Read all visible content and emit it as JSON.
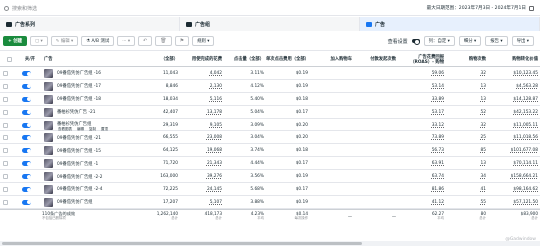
{
  "search": {
    "placeholder": "搜索和筛选"
  },
  "date_range": "最大日期范围：2023年7月3日 - 2024年7月1日",
  "level_tabs": [
    {
      "label": "广告系列",
      "icon": "folder-icon",
      "active": false
    },
    {
      "label": "广告组",
      "icon": "grid-icon",
      "active": false
    },
    {
      "label": "广告",
      "icon": "ad-icon",
      "active": true
    }
  ],
  "toolbar": {
    "create": "+ 创建",
    "copy": "▢ ▾",
    "edit": "✎ 编辑 ▾",
    "ab_test": "⚗ A/B 测试",
    "more": "··· ▾",
    "rules": "规则 ▾",
    "view_setting": "查看设置",
    "columns": "列：自定 ▾",
    "breakdown": "细分 ▾",
    "report": "报告 ▾",
    "export": "导出 ▾"
  },
  "columns": [
    "关/开",
    "广告",
    "（全部）",
    "用使完成的花费",
    "点击量（全部）",
    "单次点击费用（全部）",
    "加入购物车",
    "付款发起次数",
    "广告花费回报（ROAS）- 购物",
    "购物次数",
    "购物转化价值"
  ],
  "rows": [
    {
      "name": "09番茄凭仿广告组 -16",
      "c1": "11,043",
      "c2": "4,042",
      "c3": "3.11%",
      "c4": "$0.19",
      "c5": "",
      "c6": "",
      "c7": "59.06",
      "c8": "32",
      "c9": "$10,123.45"
    },
    {
      "name": "09番茄凭仿广告组 -17",
      "c1": "8,846",
      "c2": "2,130",
      "c3": "4.12%",
      "c4": "$0.19",
      "c5": "",
      "c6": "",
      "c7": "53.14",
      "c8": "13",
      "c9": "$4,563.28"
    },
    {
      "name": "09番茄凭仿广告组 -18",
      "c1": "18,034",
      "c2": "5,116",
      "c3": "5.40%",
      "c4": "$0.18",
      "c5": "",
      "c6": "",
      "c7": "33.89",
      "c8": "13",
      "c9": "$14,128.87"
    },
    {
      "name": "番柏衫凭仿广告 -21",
      "c1": "42,407",
      "c2": "13,178",
      "c3": "5.04%",
      "c4": "$0.17",
      "c5": "",
      "c6": "",
      "c7": "53.17",
      "c8": "52",
      "c9": "$42,153.22"
    },
    {
      "name": "番柏衫凭仿广告组",
      "c1": "29,319",
      "c2": "9,105",
      "c3": "3.09%",
      "c4": "$0.20",
      "c5": "",
      "c6": "",
      "c7": "33.12",
      "c8": "32",
      "c9": "$11,005.11",
      "actions": [
        "查看图表",
        "编辑",
        "复制",
        "置顶"
      ]
    },
    {
      "name": "09番茄凭仿广告组 -21",
      "c1": "66,555",
      "c2": "23,008",
      "c3": "3.04%",
      "c4": "$0.20",
      "c5": "",
      "c6": "",
      "c7": "73.89",
      "c8": "25",
      "c9": "$11,018.56"
    },
    {
      "name": "09番茄凭仿广告组 -15",
      "c1": "64,125",
      "c2": "19,068",
      "c3": "3.74%",
      "c4": "$0.18",
      "c5": "",
      "c6": "",
      "c7": "56.73",
      "c8": "85",
      "c9": "$101,677.08"
    },
    {
      "name": "09番茄凭仿广告组 -1",
      "c1": "71,720",
      "c2": "21,343",
      "c3": "4.44%",
      "c4": "$0.17",
      "c5": "",
      "c6": "",
      "c7": "63.91",
      "c8": "13",
      "c9": "$70,114.11"
    },
    {
      "name": "09番茄凭仿广告组 -2-2",
      "c1": "163,000",
      "c2": "39,276",
      "c3": "3.56%",
      "c4": "$0.19",
      "c5": "",
      "c6": "",
      "c7": "63.74",
      "c8": "34",
      "c9": "$158,664.21"
    },
    {
      "name": "09番茄凭仿广告组 -2-4",
      "c1": "72,225",
      "c2": "24,145",
      "c3": "5.68%",
      "c4": "$0.17",
      "c5": "",
      "c6": "",
      "c7": "81.86",
      "c8": "41",
      "c9": "$98,164.62"
    },
    {
      "name": "09番茄凭仿广告组",
      "c1": "17,207",
      "c2": "5,107",
      "c3": "3.88%",
      "c4": "$0.19",
      "c5": "",
      "c6": "",
      "c7": "41.12",
      "c8": "55",
      "c9": "$57,121.50"
    }
  ],
  "footer": {
    "name": "110条广告的成效",
    "name_sub": "不包括已删除项",
    "c1": "1,262,140",
    "c1s": "总计",
    "c2": "418,173",
    "c2s": "总计",
    "c3": "4.23%",
    "c3s": "平均",
    "c4": "$0.14",
    "c4s": "每次操作",
    "c5": "—",
    "c6": "—",
    "c7": "62.27",
    "c7s": "平均",
    "c8": "80",
    "c8s": "总计",
    "c9": "$83,900",
    "c9s": "总计"
  },
  "watermark": "@Gadwindow"
}
